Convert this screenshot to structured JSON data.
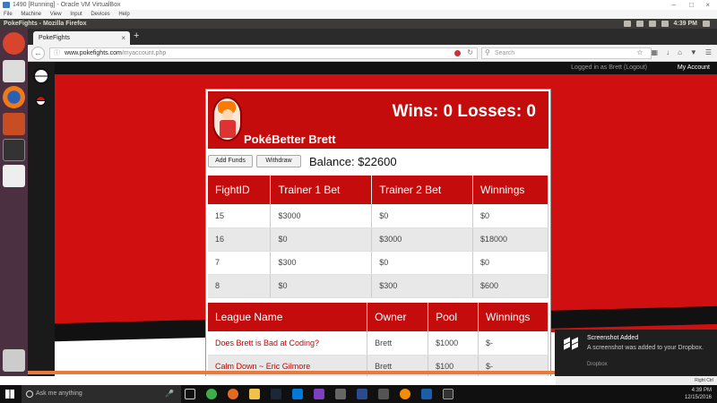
{
  "vbox": {
    "title": "1490 [Running] - Oracle VM VirtualBox",
    "menu": [
      "File",
      "Machine",
      "View",
      "Input",
      "Devices",
      "Help"
    ],
    "status_right": "Right Ctrl"
  },
  "ubuntu": {
    "window_title": "PokeFights - Mozilla Firefox",
    "clock": "4:39 PM"
  },
  "firefox": {
    "tab_label": "PokeFights",
    "url_domain": "www.pokefights.com",
    "url_path": "/myaccount.php",
    "search_placeholder": "Search"
  },
  "site": {
    "logged_in": "Logged in as Brett (Logout)",
    "my_account": "My Account"
  },
  "profile": {
    "record": "Wins: 0 Losses: 0",
    "name": "PokéBetter Brett",
    "add_funds": "Add Funds",
    "withdraw": "Withdraw",
    "balance": "Balance: $22600"
  },
  "fights": {
    "headers": [
      "FightID",
      "Trainer 1 Bet",
      "Trainer 2 Bet",
      "Winnings"
    ],
    "rows": [
      [
        "15",
        "$3000",
        "$0",
        "$0"
      ],
      [
        "16",
        "$0",
        "$3000",
        "$18000"
      ],
      [
        "7",
        "$300",
        "$0",
        "$0"
      ],
      [
        "8",
        "$0",
        "$300",
        "$600"
      ]
    ]
  },
  "leagues": {
    "headers": [
      "League Name",
      "Owner",
      "Pool",
      "Winnings"
    ],
    "rows": [
      [
        "Does Brett is Bad at Coding?",
        "Brett",
        "$1000",
        "$-"
      ],
      [
        "Calm Down ~ Eric Gilmore",
        "Brett",
        "$100",
        "$-"
      ]
    ]
  },
  "notification": {
    "title": "Screenshot Added",
    "body": "A screenshot was added to your Dropbox.",
    "source": "Dropbox"
  },
  "taskbar": {
    "search_placeholder": "Ask me anything",
    "time": "4:39 PM",
    "date": "12/15/2016"
  },
  "colors": {
    "brand_red": "#c40c0c",
    "page_red": "#d01010",
    "launcher": "#4a3040"
  }
}
